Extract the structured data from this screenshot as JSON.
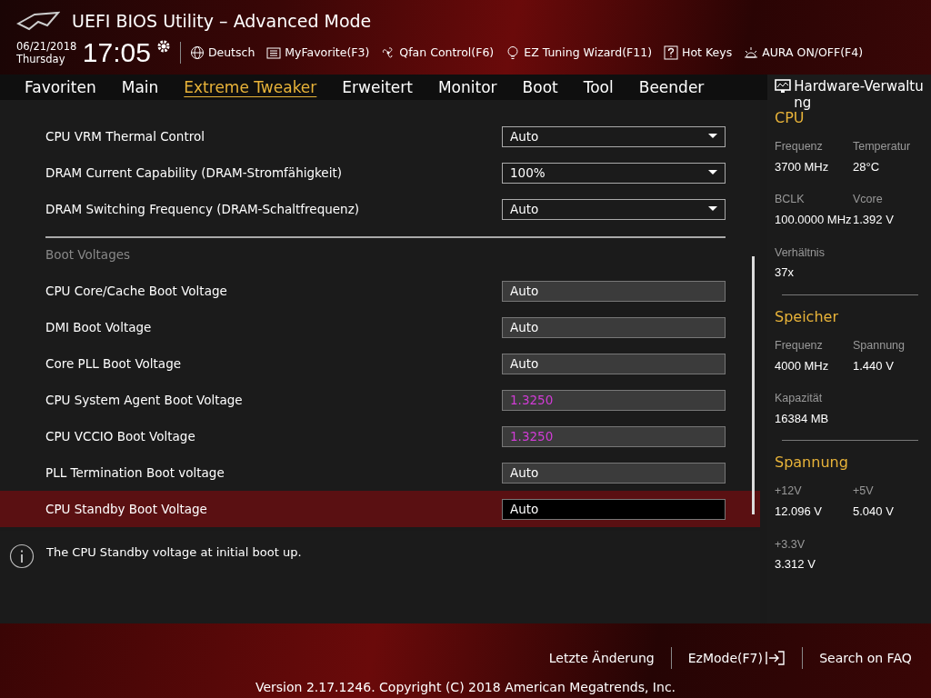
{
  "window": {
    "title": "UEFI BIOS Utility – Advanced Mode"
  },
  "header": {
    "date": "06/21/2018",
    "weekday": "Thursday",
    "time": "17:05",
    "tools": [
      {
        "kind": "globe",
        "label": "Deutsch"
      },
      {
        "kind": "list",
        "label": "MyFavorite(F3)"
      },
      {
        "kind": "fan",
        "label": "Qfan Control(F6)"
      },
      {
        "kind": "bulb",
        "label": "EZ Tuning Wizard(F11)"
      },
      {
        "kind": "help",
        "label": "Hot Keys"
      },
      {
        "kind": "aura",
        "label": "AURA ON/OFF(F4)"
      }
    ]
  },
  "tabs": [
    {
      "label": "Favoriten",
      "selected": false
    },
    {
      "label": "Main",
      "selected": false
    },
    {
      "label": "Extreme Tweaker",
      "selected": true
    },
    {
      "label": "Erweitert",
      "selected": false
    },
    {
      "label": "Monitor",
      "selected": false
    },
    {
      "label": "Boot",
      "selected": false
    },
    {
      "label": "Tool",
      "selected": false
    },
    {
      "label": "Beender",
      "selected": false
    }
  ],
  "settings": [
    {
      "kind": "dropdown",
      "label": "CPU VRM Thermal Control",
      "value": "Auto",
      "selected": false,
      "modified": false
    },
    {
      "kind": "dropdown",
      "label": "DRAM Current Capability (DRAM-Stromfähigkeit)",
      "value": "100%",
      "selected": false,
      "modified": false
    },
    {
      "kind": "dropdown",
      "label": "DRAM Switching Frequency (DRAM-Schaltfrequenz)",
      "value": "Auto",
      "selected": false,
      "modified": false
    },
    {
      "kind": "section",
      "label": "Boot Voltages"
    },
    {
      "kind": "field",
      "label": "CPU Core/Cache Boot Voltage",
      "value": "Auto",
      "selected": false,
      "modified": false
    },
    {
      "kind": "field",
      "label": "DMI Boot Voltage",
      "value": "Auto",
      "selected": false,
      "modified": false
    },
    {
      "kind": "field",
      "label": "Core PLL Boot Voltage",
      "value": "Auto",
      "selected": false,
      "modified": false
    },
    {
      "kind": "field",
      "label": "CPU System Agent Boot Voltage",
      "value": "1.3250",
      "selected": false,
      "modified": true
    },
    {
      "kind": "field",
      "label": "CPU VCCIO Boot Voltage",
      "value": "1.3250",
      "selected": false,
      "modified": true
    },
    {
      "kind": "field",
      "label": "PLL Termination Boot voltage",
      "value": "Auto",
      "selected": false,
      "modified": false
    },
    {
      "kind": "field",
      "label": "CPU Standby Boot Voltage",
      "value": "Auto",
      "selected": true,
      "modified": false
    }
  ],
  "help": "The CPU Standby voltage at initial boot up.",
  "hardware": {
    "title": "Hardware-Verwaltung",
    "sections": [
      {
        "title": "CPU",
        "items": [
          {
            "label": "Frequenz",
            "value": "3700 MHz"
          },
          {
            "label": "Temperatur",
            "value": "28°C"
          },
          {
            "label": "BCLK",
            "value": "100.0000 MHz"
          },
          {
            "label": "Vcore",
            "value": "1.392 V"
          },
          {
            "label": "Verhältnis",
            "value": "37x"
          }
        ]
      },
      {
        "title": "Speicher",
        "items": [
          {
            "label": "Frequenz",
            "value": "4000 MHz"
          },
          {
            "label": "Spannung",
            "value": "1.440 V"
          },
          {
            "label": "Kapazität",
            "value": "16384 MB"
          }
        ]
      },
      {
        "title": "Spannung",
        "items": [
          {
            "label": "+12V",
            "value": "12.096 V"
          },
          {
            "label": "+5V",
            "value": "5.040 V"
          },
          {
            "label": "+3.3V",
            "value": "3.312 V"
          }
        ]
      }
    ]
  },
  "footer": {
    "links": [
      "Letzte Änderung",
      "EzMode(F7)",
      "Search on FAQ"
    ],
    "version": "Version 2.17.1246. Copyright (C) 2018 American Megatrends, Inc."
  }
}
